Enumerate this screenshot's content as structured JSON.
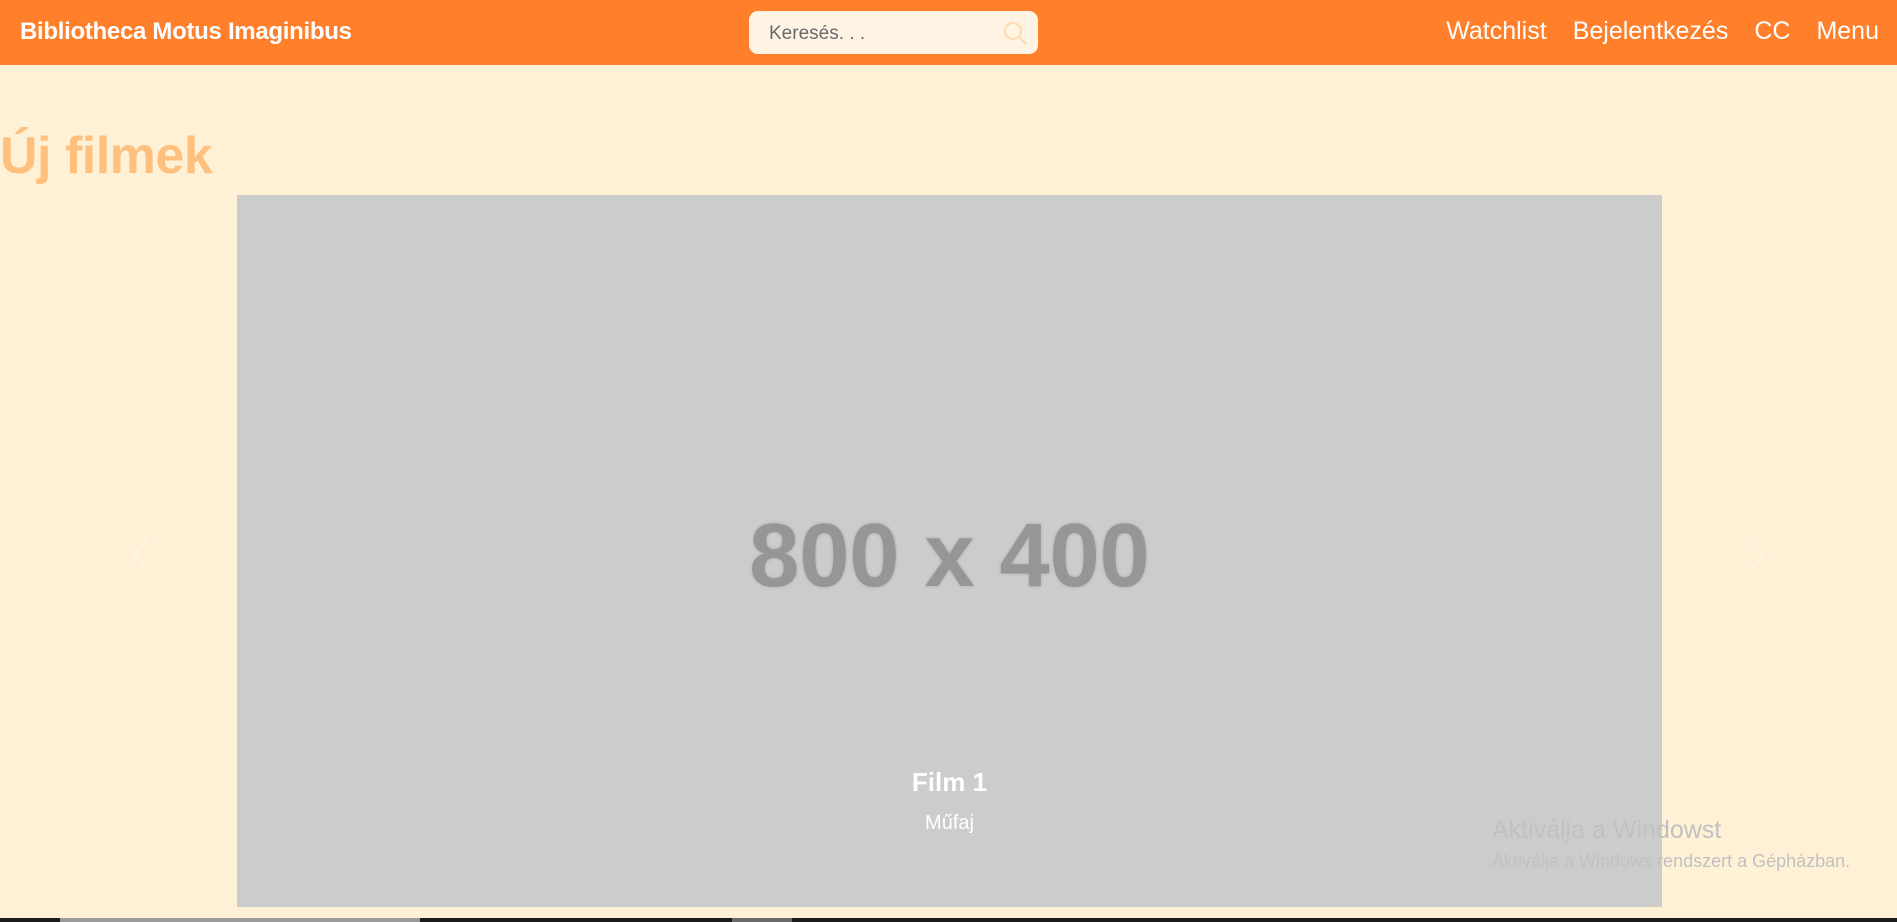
{
  "navbar": {
    "brand": "Bibliotheca Motus Imaginibus",
    "search": {
      "placeholder": "Keresés. . ."
    },
    "links": [
      "Watchlist",
      "Bejelentkezés",
      "CC",
      "Menu"
    ]
  },
  "section": {
    "title": "Új filmek"
  },
  "carousel": {
    "placeholder_text": "800 x 400",
    "caption_title": "Film 1",
    "caption_subtitle": "Műfaj"
  },
  "watermark": {
    "title": "Aktiválja a Windowst",
    "subtitle": "Aktiválja a Windows rendszert a Gépházban."
  },
  "colors": {
    "navbar": "#ff7f2a",
    "page_background": "#fff1d6",
    "section_title": "#ffc07e",
    "carousel_placeholder": "#cccccc"
  },
  "icons": [
    "search-icon",
    "chevron-left-icon",
    "chevron-right-icon"
  ]
}
